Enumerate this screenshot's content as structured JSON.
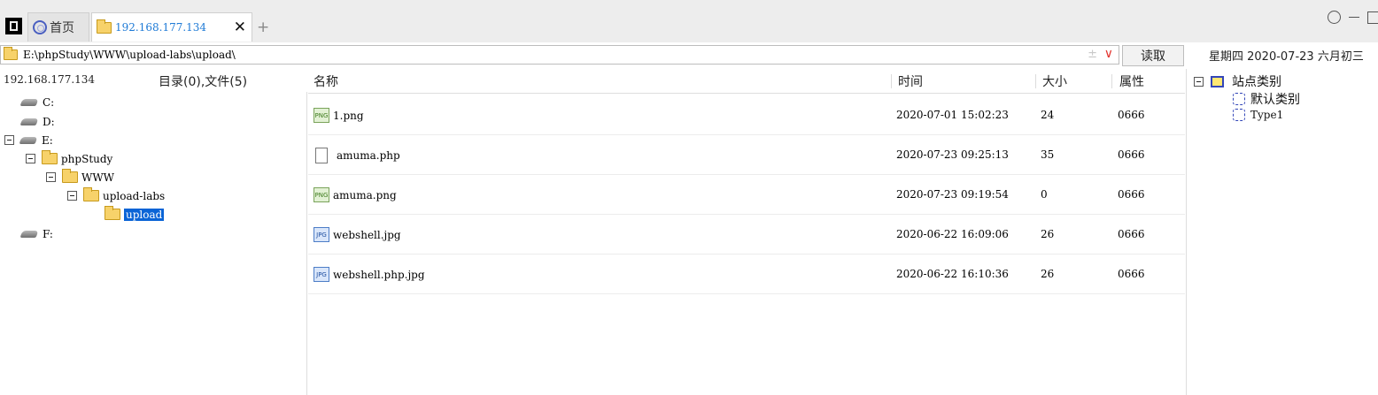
{
  "tabs": {
    "home_label": "首页",
    "host_label": "192.168.177.134",
    "close_label": "✕",
    "new_label": "+"
  },
  "pathbar": {
    "path": "E:\\phpStudy\\WWW\\upload-labs\\upload\\",
    "history_icon": "±",
    "dropdown_icon": "∨",
    "read_label": "读取"
  },
  "date_text": "星期四 2020-07-23 六月初三",
  "left": {
    "ip": "192.168.177.134",
    "count": "目录(0),文件(5)"
  },
  "tree": {
    "c": "C:",
    "d": "D:",
    "e": "E:",
    "phpstudy": "phpStudy",
    "www": "WWW",
    "uploadlabs": "upload-labs",
    "upload": "upload",
    "f": "F:"
  },
  "columns": {
    "name": "名称",
    "time": "时间",
    "size": "大小",
    "attr": "属性"
  },
  "files": [
    {
      "name": "1.png",
      "time": "2020-07-01 15:02:23",
      "size": "24",
      "attr": "0666",
      "icon": "PNG"
    },
    {
      "name": "amuma.php",
      "time": "2020-07-23 09:25:13",
      "size": "35",
      "attr": "0666",
      "icon": "doc"
    },
    {
      "name": "amuma.png",
      "time": "2020-07-23 09:19:54",
      "size": "0",
      "attr": "0666",
      "icon": "PNG"
    },
    {
      "name": "webshell.jpg",
      "time": "2020-06-22 16:09:06",
      "size": "26",
      "attr": "0666",
      "icon": "JPG"
    },
    {
      "name": "webshell.php.jpg",
      "time": "2020-06-22 16:10:36",
      "size": "26",
      "attr": "0666",
      "icon": "JPG"
    }
  ],
  "sites": {
    "root": "站点类别",
    "items": [
      "默认类别",
      "Type1"
    ]
  }
}
